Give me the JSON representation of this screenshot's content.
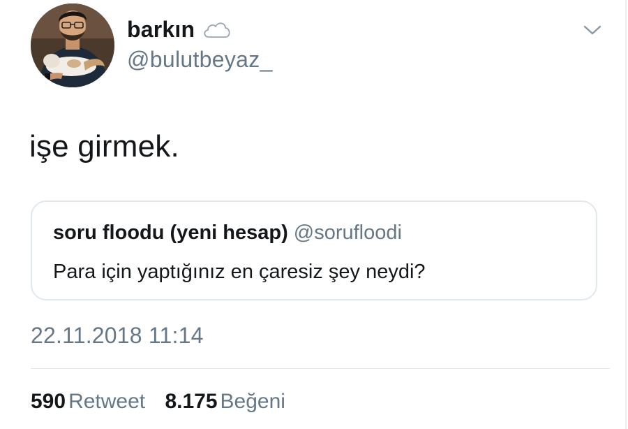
{
  "author": {
    "display_name": "barkın",
    "handle": "@bulutbeyaz_",
    "name_emoji": "cloud-icon"
  },
  "tweet": {
    "text": "işe girmek."
  },
  "quoted_tweet": {
    "display_name": "soru floodu (yeni hesap)",
    "handle": "@sorufloodi",
    "text": "Para için yaptığınız en çaresiz şey neydi?"
  },
  "timestamp": "22.11.2018 11:14",
  "stats": {
    "retweet_count": "590",
    "retweet_label": "Retweet",
    "like_count": "8.175",
    "like_label": "Beğeni"
  },
  "colors": {
    "primary_text": "#14171a",
    "secondary_text": "#657786",
    "border": "#e1e8ed"
  }
}
